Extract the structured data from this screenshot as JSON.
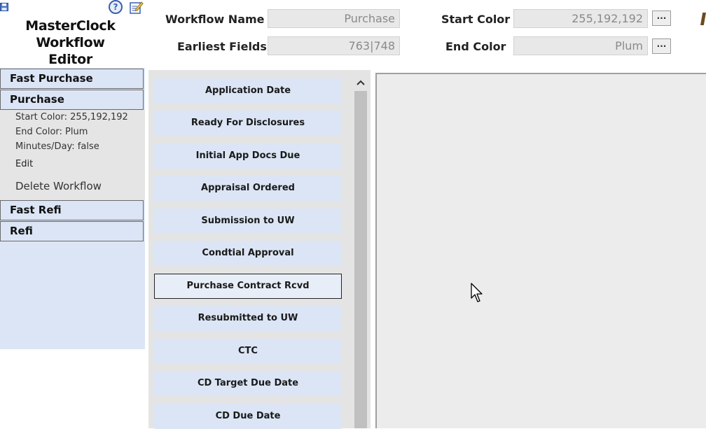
{
  "app": {
    "title_line1": "MasterClock",
    "title_line2": "Workflow Editor",
    "help_glyph": "?"
  },
  "fields": {
    "workflow_name_label": "Workflow Name",
    "workflow_name_value": "Purchase",
    "earliest_fields_label": "Earliest Fields",
    "earliest_fields_value": "763|748",
    "start_color_label": "Start Color",
    "start_color_value": "255,192,192",
    "end_color_label": "End Color",
    "end_color_value": "Plum",
    "picker_button_label": "..."
  },
  "sidebar": {
    "workflows": [
      {
        "label": "Fast Purchase"
      },
      {
        "label": "Purchase"
      },
      {
        "label": "Fast Refi"
      },
      {
        "label": "Refi"
      }
    ],
    "selected_details": {
      "start_color": "Start Color: 255,192,192",
      "end_color": "End Color: Plum",
      "minutes_per_day": "Minutes/Day: false",
      "edit_label": "Edit",
      "delete_label": "Delete Workflow"
    }
  },
  "tasks": [
    {
      "label": "Application Date"
    },
    {
      "label": "Ready For Disclosures"
    },
    {
      "label": "Initial App Docs Due"
    },
    {
      "label": "Appraisal Ordered"
    },
    {
      "label": "Submission to UW"
    },
    {
      "label": "Condtial Approval"
    },
    {
      "label": "Purchase Contract Rcvd"
    },
    {
      "label": "Resubmitted to UW"
    },
    {
      "label": "CTC"
    },
    {
      "label": "CD Target Due Date"
    },
    {
      "label": "CD Due Date"
    }
  ],
  "selected_task": "Purchase Contract Rcvd",
  "colors": {
    "accent_blue": "#dbe5f5",
    "panel_gray": "#e4e4e4",
    "help_blue": "#3a5fb0"
  },
  "icons": {
    "save": "save-icon",
    "help": "help-icon",
    "edit": "edit-icon",
    "scroll_up": "chevron-up-icon",
    "cursor": "mouse-cursor-icon"
  }
}
